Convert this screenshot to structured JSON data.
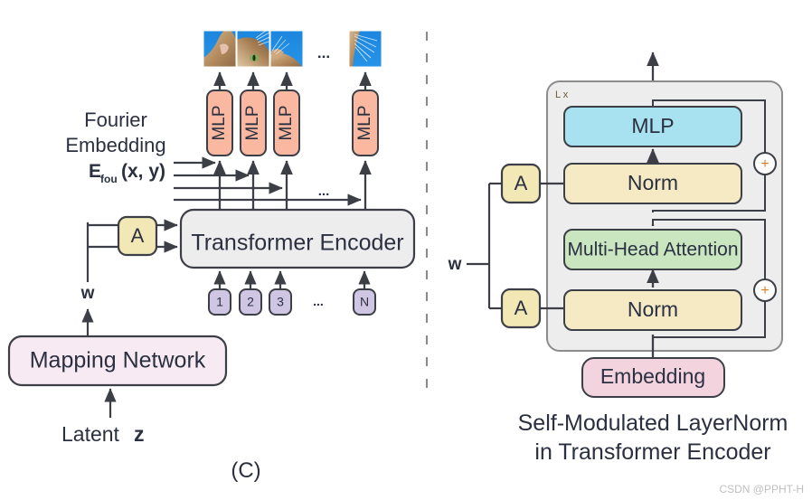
{
  "figure": {
    "panel_label": "(C)",
    "watermark": "CSDN @PPHT-H"
  },
  "left_panel": {
    "name": "generator-architecture",
    "fourier": {
      "line1": "Fourier",
      "line2": "Embedding",
      "symbol_main": "E",
      "symbol_sub": "fou",
      "symbol_args": "(x, y)"
    },
    "mlp_label": "MLP",
    "mlp_blocks": [
      "MLP",
      "MLP",
      "MLP",
      "MLP"
    ],
    "patch_ellipsis": "...",
    "token_ellipsis": "...",
    "row_ellipsis": "...",
    "encoder_label": "Transformer Encoder",
    "modulation_label": "A",
    "modulation_blocks": [
      "A"
    ],
    "tokens": [
      "1",
      "2",
      "3",
      "N"
    ],
    "w_label": "w",
    "mapping_label": "Mapping  Network",
    "latent_label": "Latent",
    "latent_symbol": "z"
  },
  "right_panel": {
    "name": "self-modulated-layernorm",
    "repeat_label": "L x",
    "blocks": {
      "mlp": "MLP",
      "norm_top": "Norm",
      "attention": "Multi-Head Attention",
      "norm_bottom": "Norm",
      "embedding": "Embedding"
    },
    "modulation_top": "A",
    "modulation_bottom": "A",
    "residual_plus_top": "+",
    "residual_plus_bottom": "+",
    "w_label": "w",
    "caption_line1": "Self-Modulated LayerNorm",
    "caption_line2": "in Transformer Encoder"
  },
  "colors": {
    "mlp_peach": "#f9b89f",
    "mlp_blue": "#a8e1ef",
    "modulation_yellow": "#f2e8b6",
    "attention_green": "#c9e6c1",
    "norm_cream": "#f5eac4",
    "token_purple": "#cfc6e4",
    "encoder_gray": "#ededed",
    "mapping_pink": "#f7eaf3",
    "embedding_pink": "#f3d3de",
    "stroke": "#3c3f46",
    "text": "#2b3040",
    "sky": "#1e8ae0",
    "watermark": "#bfbfbf"
  }
}
